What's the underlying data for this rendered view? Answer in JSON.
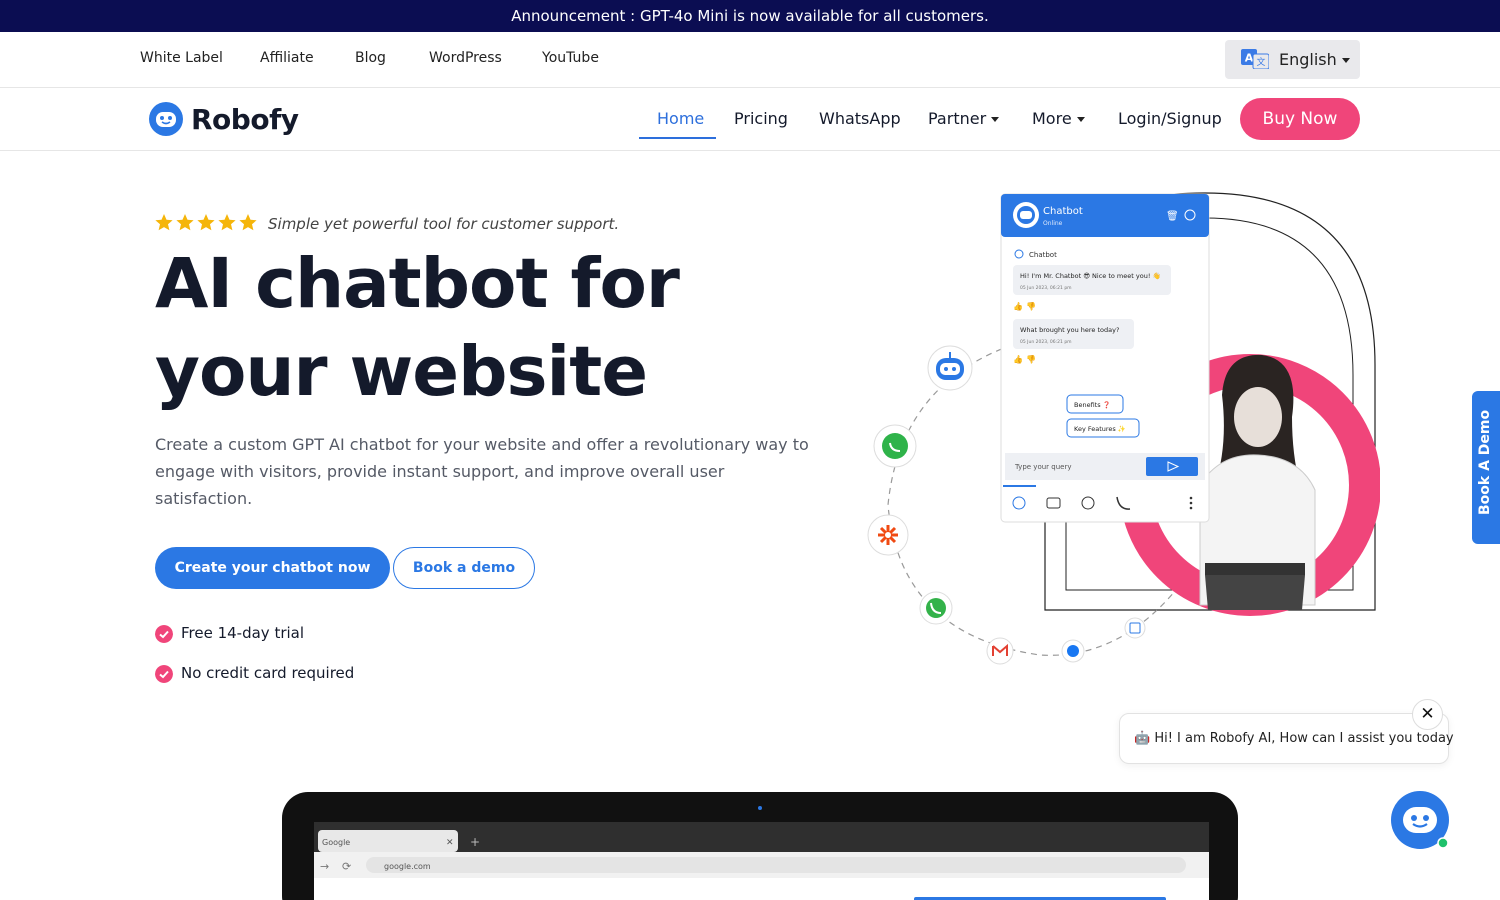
{
  "announcement": "Announcement : GPT-4o Mini is now available for all customers.",
  "topbar": {
    "links": [
      "White Label",
      "Affiliate",
      "Blog",
      "WordPress",
      "YouTube"
    ],
    "language": "English"
  },
  "brand": {
    "name": "Robofy"
  },
  "nav": {
    "items": [
      "Home",
      "Pricing",
      "WhatsApp",
      "Partner",
      "More",
      "Login/Signup"
    ],
    "active": "Home",
    "buy_label": "Buy Now"
  },
  "hero": {
    "tagline": "Simple yet powerful tool for customer support.",
    "rating_stars": 5,
    "heading_line1": "AI chatbot for",
    "heading_line2": "your website",
    "description": "Create a custom GPT AI chatbot for your website and offer a revolutionary way to engage with visitors, provide instant support, and improve overall user satisfaction.",
    "primary_cta": "Create your chatbot now",
    "secondary_cta": "Book a demo",
    "features": [
      "Free 14-day trial",
      "No credit card required"
    ]
  },
  "chat_widget_mock": {
    "title": "Chatbot",
    "status": "Online",
    "sender": "Chatbot",
    "msg1": "Hi! I'm Mr. Chatbot 😎 Nice to meet you! 👋",
    "msg1_time": "05 Jun 2023, 06:21 pm",
    "msg2": "What brought you here today?",
    "msg2_time": "05 Jun 2023, 06:21 pm",
    "option1": "Benefits ❓",
    "option2": "Key Features ✨",
    "input_placeholder": "Type your query"
  },
  "side_tab": "Book A Demo",
  "chat_popup": {
    "text": "🤖 Hi! I am Robofy AI, How can I assist you today",
    "close": "✕"
  },
  "browser_mock": {
    "tab": "Google",
    "url": "google.com"
  },
  "colors": {
    "announcement_bg": "#0b0d52",
    "accent_blue": "#2b78e4",
    "accent_pink": "#f0457a",
    "star": "#f5b50a"
  },
  "icons": [
    "translate-icon",
    "robot-logo-icon",
    "star-icon",
    "check-circle-icon",
    "whatsapp-icon",
    "zapier-icon",
    "phone-icon",
    "gmail-icon",
    "messenger-icon",
    "calendar-icon",
    "bot-avatar-icon",
    "close-icon"
  ]
}
